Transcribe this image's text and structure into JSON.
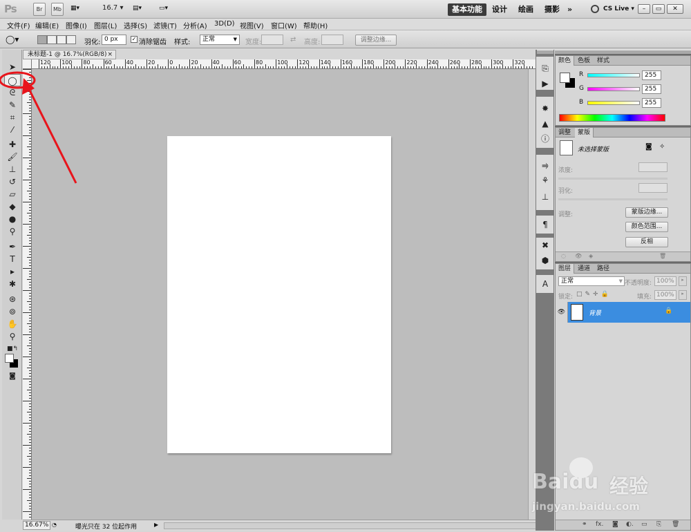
{
  "appbar": {
    "logo": "Ps",
    "bridge_label": "Br",
    "minibridge_label": "Mb",
    "zoom_value": "16.7",
    "workspaces": [
      "基本功能",
      "设计",
      "绘画",
      "摄影"
    ],
    "more": "»",
    "cslive_label": "CS Live",
    "window_controls": [
      "–",
      "▭",
      "✕"
    ]
  },
  "menu": [
    "文件(F)",
    "编辑(E)",
    "图像(I)",
    "图层(L)",
    "选择(S)",
    "滤镜(T)",
    "分析(A)",
    "3D(D)",
    "视图(V)",
    "窗口(W)",
    "帮助(H)"
  ],
  "options": {
    "feather_label": "羽化:",
    "feather_value": "0 px",
    "antialias_label": "消除锯齿",
    "antialias_checked": true,
    "style_label": "样式:",
    "style_value": "正常",
    "width_label": "宽度:",
    "height_label": "高度:",
    "refine_edge": "调整边缘..."
  },
  "document": {
    "tab_title": "未标题-1 @ 16.7%(RGB/8)",
    "close": "×",
    "ruler_h_labels": [
      "120",
      "100",
      "80",
      "60",
      "40",
      "20",
      "0",
      "20",
      "40",
      "60",
      "80",
      "100",
      "120",
      "140",
      "160",
      "180",
      "200",
      "220",
      "240",
      "260",
      "280",
      "300",
      "320"
    ],
    "status_zoom": "16.67%",
    "status_text": "曝光只在 32 位起作用"
  },
  "color_panel": {
    "tabs": [
      "颜色",
      "色板",
      "样式"
    ],
    "r_label": "R",
    "g_label": "G",
    "b_label": "B",
    "r": "255",
    "g": "255",
    "b": "255"
  },
  "mask_panel": {
    "tabs": [
      "调整",
      "蒙版"
    ],
    "no_mask": "未选择蒙版",
    "density_label": "浓度:",
    "feather_label": "羽化:",
    "adjust_label": "调整:",
    "mask_edge_btn": "蒙版边缘...",
    "color_range_btn": "颜色范围...",
    "invert_btn": "反相"
  },
  "layers_panel": {
    "tabs": [
      "图层",
      "通道",
      "路径"
    ],
    "blend_mode": "正常",
    "opacity_label": "不透明度:",
    "opacity_value": "100%",
    "lock_label": "锁定:",
    "fill_label": "填充:",
    "fill_value": "100%",
    "layer_name": "背景"
  },
  "watermark": {
    "brand": "Baidu",
    "cn": "经验",
    "url": "jingyan.baidu.com"
  },
  "colors": {
    "accent_layer": "#3b8de0",
    "annotation_red": "#e8141b"
  }
}
